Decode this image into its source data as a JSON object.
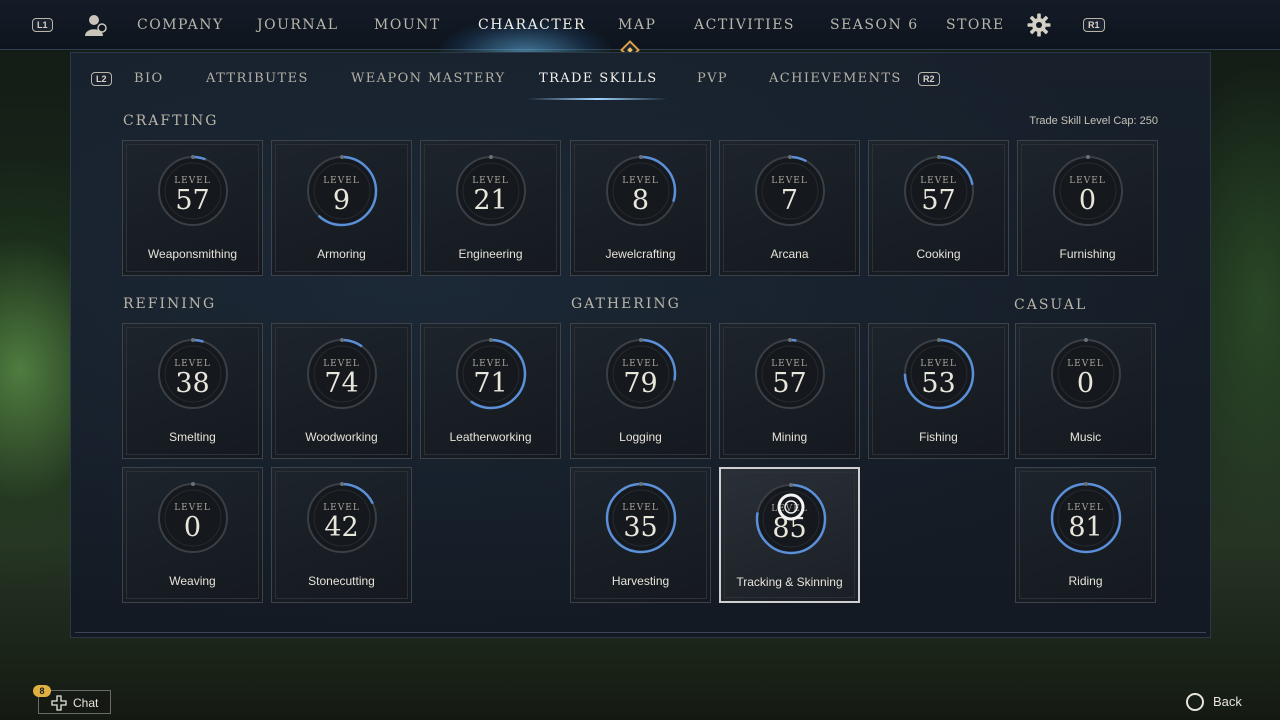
{
  "top_nav": {
    "left_button": "L1",
    "right_button": "R1",
    "items": [
      "COMPANY",
      "JOURNAL",
      "MOUNT",
      "CHARACTER",
      "MAP",
      "ACTIVITIES",
      "SEASON 6",
      "STORE"
    ],
    "active": "CHARACTER"
  },
  "sub_nav": {
    "left_button": "L2",
    "right_button": "R2",
    "items": [
      "BIO",
      "ATTRIBUTES",
      "WEAPON MASTERY",
      "TRADE SKILLS",
      "PVP",
      "ACHIEVEMENTS"
    ],
    "active": "TRADE SKILLS"
  },
  "level_cap": "Trade Skill Level Cap: 250",
  "level_word": "LEVEL",
  "sections": {
    "crafting": "CRAFTING",
    "refining": "REFINING",
    "gathering": "GATHERING",
    "casual": "CASUAL"
  },
  "skills": [
    {
      "name": "Weaponsmithing",
      "level": "57",
      "progress": 0.06
    },
    {
      "name": "Armoring",
      "level": "9",
      "progress": 0.62
    },
    {
      "name": "Engineering",
      "level": "21",
      "progress": 0.0
    },
    {
      "name": "Jewelcrafting",
      "level": "8",
      "progress": 0.3
    },
    {
      "name": "Arcana",
      "level": "7",
      "progress": 0.08
    },
    {
      "name": "Cooking",
      "level": "57",
      "progress": 0.22
    },
    {
      "name": "Furnishing",
      "level": "0",
      "progress": 0.0
    },
    {
      "name": "Smelting",
      "level": "38",
      "progress": 0.05
    },
    {
      "name": "Woodworking",
      "level": "74",
      "progress": 0.1
    },
    {
      "name": "Leatherworking",
      "level": "71",
      "progress": 0.6
    },
    {
      "name": "Logging",
      "level": "79",
      "progress": 0.28
    },
    {
      "name": "Mining",
      "level": "57",
      "progress": 0.03
    },
    {
      "name": "Fishing",
      "level": "53",
      "progress": 0.75
    },
    {
      "name": "Music",
      "level": "0",
      "progress": 0.0
    },
    {
      "name": "Weaving",
      "level": "0",
      "progress": 0.0
    },
    {
      "name": "Stonecutting",
      "level": "42",
      "progress": 0.18
    },
    {
      "name": "Harvesting",
      "level": "35",
      "progress": 1.0
    },
    {
      "name": "Tracking & Skinning",
      "level": "85",
      "progress": 0.78
    },
    {
      "name": "Riding",
      "level": "81",
      "progress": 1.0
    }
  ],
  "selected_skill": "Tracking & Skinning",
  "chat": {
    "badge": "8",
    "label": "Chat"
  },
  "back": {
    "label": "Back"
  },
  "colors": {
    "progress_ring": "#5b8fd8",
    "ring_track": "#3a3f46",
    "accent_gold": "#d8a24a"
  }
}
